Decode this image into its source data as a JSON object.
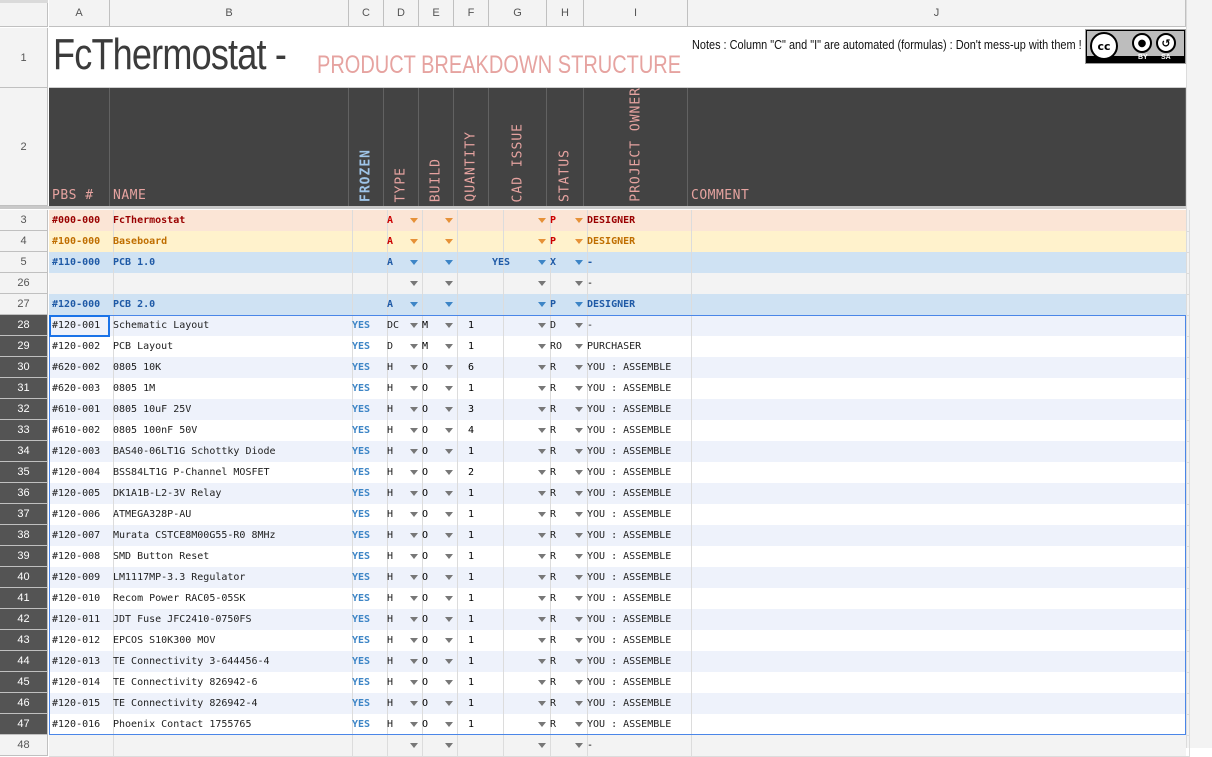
{
  "columns": [
    "A",
    "B",
    "C",
    "D",
    "E",
    "F",
    "G",
    "H",
    "I",
    "J"
  ],
  "title": {
    "main": "FcThermostat -",
    "sub": "PRODUCT BREAKDOWN STRUCTURE",
    "notes": "Notes : Column \"C\" and \"I\" are automated (formulas) : Don't mess-up with them !",
    "license": {
      "badge": "cc",
      "by": "BY",
      "sa": "SA"
    }
  },
  "headers": {
    "pbs": "PBS #",
    "name": "NAME",
    "frozen": "FROZEN",
    "type": "TYPE",
    "build": "BUILD",
    "quantity": "QUANTITY",
    "cad_issue": "CAD ISSUE",
    "status": "STATUS",
    "project_owner": "PROJECT OWNER",
    "comment": "COMMENT"
  },
  "row_numbers": {
    "title": "1",
    "header": "2"
  },
  "rows": [
    {
      "n": "3",
      "pbs": "#000-000",
      "name": "FcThermostat",
      "frozen": "",
      "type": "A",
      "build": "",
      "qty": "",
      "cad": "",
      "status": "P",
      "owner": "DESIGNER",
      "style": "l0"
    },
    {
      "n": "4",
      "pbs": "#100-000",
      "name": "Baseboard",
      "frozen": "",
      "type": "A",
      "build": "",
      "qty": "",
      "cad": "",
      "status": "P",
      "owner": "DESIGNER",
      "style": "l1"
    },
    {
      "n": "5",
      "pbs": "#110-000",
      "name": "PCB 1.0",
      "frozen": "",
      "type": "A",
      "build": "",
      "qty": "",
      "cad": "YES",
      "status": "X",
      "owner": "-",
      "style": "l2"
    },
    {
      "n": "26",
      "pbs": "",
      "name": "",
      "frozen": "",
      "type": "",
      "build": "",
      "qty": "",
      "cad": "",
      "status": "",
      "owner": "-",
      "style": "empty"
    },
    {
      "n": "27",
      "pbs": "#120-000",
      "name": "PCB 2.0",
      "frozen": "",
      "type": "A",
      "build": "",
      "qty": "",
      "cad": "",
      "status": "P",
      "owner": "DESIGNER",
      "style": "l2"
    },
    {
      "n": "28",
      "pbs": "#120-001",
      "name": "Schematic Layout",
      "frozen": "YES",
      "type": "DC",
      "build": "M",
      "qty": "1",
      "cad": "",
      "status": "D",
      "owner": "-",
      "style": "item"
    },
    {
      "n": "29",
      "pbs": "#120-002",
      "name": "PCB Layout",
      "frozen": "YES",
      "type": "D",
      "build": "M",
      "qty": "1",
      "cad": "",
      "status": "RO",
      "owner": "PURCHASER",
      "style": "item"
    },
    {
      "n": "30",
      "pbs": "#620-002",
      "name": "0805 10K",
      "frozen": "YES",
      "type": "H",
      "build": "O",
      "qty": "6",
      "cad": "",
      "status": "R",
      "owner": "YOU : ASSEMBLE",
      "style": "item"
    },
    {
      "n": "31",
      "pbs": "#620-003",
      "name": "0805 1M",
      "frozen": "YES",
      "type": "H",
      "build": "O",
      "qty": "1",
      "cad": "",
      "status": "R",
      "owner": "YOU : ASSEMBLE",
      "style": "item"
    },
    {
      "n": "32",
      "pbs": "#610-001",
      "name": "0805 10uF 25V",
      "frozen": "YES",
      "type": "H",
      "build": "O",
      "qty": "3",
      "cad": "",
      "status": "R",
      "owner": "YOU : ASSEMBLE",
      "style": "item"
    },
    {
      "n": "33",
      "pbs": "#610-002",
      "name": "0805 100nF 50V",
      "frozen": "YES",
      "type": "H",
      "build": "O",
      "qty": "4",
      "cad": "",
      "status": "R",
      "owner": "YOU : ASSEMBLE",
      "style": "item"
    },
    {
      "n": "34",
      "pbs": "#120-003",
      "name": "BAS40-06LT1G Schottky Diode",
      "frozen": "YES",
      "type": "H",
      "build": "O",
      "qty": "1",
      "cad": "",
      "status": "R",
      "owner": "YOU : ASSEMBLE",
      "style": "item"
    },
    {
      "n": "35",
      "pbs": "#120-004",
      "name": "BSS84LT1G P-Channel MOSFET",
      "frozen": "YES",
      "type": "H",
      "build": "O",
      "qty": "2",
      "cad": "",
      "status": "R",
      "owner": "YOU : ASSEMBLE",
      "style": "item"
    },
    {
      "n": "36",
      "pbs": "#120-005",
      "name": "DK1A1B-L2-3V Relay",
      "frozen": "YES",
      "type": "H",
      "build": "O",
      "qty": "1",
      "cad": "",
      "status": "R",
      "owner": "YOU : ASSEMBLE",
      "style": "item"
    },
    {
      "n": "37",
      "pbs": "#120-006",
      "name": "ATMEGA328P-AU",
      "frozen": "YES",
      "type": "H",
      "build": "O",
      "qty": "1",
      "cad": "",
      "status": "R",
      "owner": "YOU : ASSEMBLE",
      "style": "item"
    },
    {
      "n": "38",
      "pbs": "#120-007",
      "name": "Murata CSTCE8M00G55-R0 8MHz",
      "frozen": "YES",
      "type": "H",
      "build": "O",
      "qty": "1",
      "cad": "",
      "status": "R",
      "owner": "YOU : ASSEMBLE",
      "style": "item"
    },
    {
      "n": "39",
      "pbs": "#120-008",
      "name": "SMD Button Reset",
      "frozen": "YES",
      "type": "H",
      "build": "O",
      "qty": "1",
      "cad": "",
      "status": "R",
      "owner": "YOU : ASSEMBLE",
      "style": "item"
    },
    {
      "n": "40",
      "pbs": "#120-009",
      "name": "LM1117MP-3.3 Regulator",
      "frozen": "YES",
      "type": "H",
      "build": "O",
      "qty": "1",
      "cad": "",
      "status": "R",
      "owner": "YOU : ASSEMBLE",
      "style": "item"
    },
    {
      "n": "41",
      "pbs": "#120-010",
      "name": "Recom Power RAC05-05SK",
      "frozen": "YES",
      "type": "H",
      "build": "O",
      "qty": "1",
      "cad": "",
      "status": "R",
      "owner": "YOU : ASSEMBLE",
      "style": "item"
    },
    {
      "n": "42",
      "pbs": "#120-011",
      "name": "JDT Fuse JFC2410-0750FS",
      "frozen": "YES",
      "type": "H",
      "build": "O",
      "qty": "1",
      "cad": "",
      "status": "R",
      "owner": "YOU : ASSEMBLE",
      "style": "item"
    },
    {
      "n": "43",
      "pbs": "#120-012",
      "name": "EPCOS S10K300 MOV",
      "frozen": "YES",
      "type": "H",
      "build": "O",
      "qty": "1",
      "cad": "",
      "status": "R",
      "owner": "YOU : ASSEMBLE",
      "style": "item"
    },
    {
      "n": "44",
      "pbs": "#120-013",
      "name": "TE Connectivity 3-644456-4",
      "frozen": "YES",
      "type": "H",
      "build": "O",
      "qty": "1",
      "cad": "",
      "status": "R",
      "owner": "YOU : ASSEMBLE",
      "style": "item"
    },
    {
      "n": "45",
      "pbs": "#120-014",
      "name": "TE Connectivity 826942-6",
      "frozen": "YES",
      "type": "H",
      "build": "O",
      "qty": "1",
      "cad": "",
      "status": "R",
      "owner": "YOU : ASSEMBLE",
      "style": "item"
    },
    {
      "n": "46",
      "pbs": "#120-015",
      "name": "TE Connectivity 826942-4",
      "frozen": "YES",
      "type": "H",
      "build": "O",
      "qty": "1",
      "cad": "",
      "status": "R",
      "owner": "YOU : ASSEMBLE",
      "style": "item"
    },
    {
      "n": "47",
      "pbs": "#120-016",
      "name": "Phoenix Contact 1755765",
      "frozen": "YES",
      "type": "H",
      "build": "O",
      "qty": "1",
      "cad": "",
      "status": "R",
      "owner": "YOU : ASSEMBLE",
      "style": "item"
    },
    {
      "n": "48",
      "pbs": "",
      "name": "",
      "frozen": "",
      "type": "",
      "build": "",
      "qty": "",
      "cad": "",
      "status": "",
      "owner": "-",
      "style": "empty"
    }
  ],
  "styles": {
    "l0": {
      "bg": "#fbe5d6",
      "pbs_color": "#990000",
      "name_color": "#990000",
      "owner_color": "#990000",
      "arrow": "orange",
      "type_color": "#cc0000",
      "bold": true
    },
    "l1": {
      "bg": "#fff2cc",
      "pbs_color": "#bf6e00",
      "name_color": "#bf6e00",
      "owner_color": "#bf6e00",
      "arrow": "orange",
      "type_color": "#cc0000",
      "bold": true
    },
    "l2": {
      "bg": "#cfe2f3",
      "pbs_color": "#1f5aa6",
      "name_color": "#1f5aa6",
      "owner_color": "#1f5aa6",
      "arrow": "blue",
      "type_color": "#1f5aa6",
      "bold": true
    },
    "empty": {
      "bg": "#f3f3f3",
      "pbs_color": "#000",
      "name_color": "#000",
      "owner_color": "#000",
      "arrow": "grey",
      "type_color": "#000",
      "bold": false
    },
    "item": {
      "bg": "#eef2fb",
      "alt_bg": "#ffffff",
      "pbs_color": "#222",
      "name_color": "#222",
      "owner_color": "#222",
      "arrow": "grey",
      "type_color": "#222",
      "bold": false
    }
  }
}
